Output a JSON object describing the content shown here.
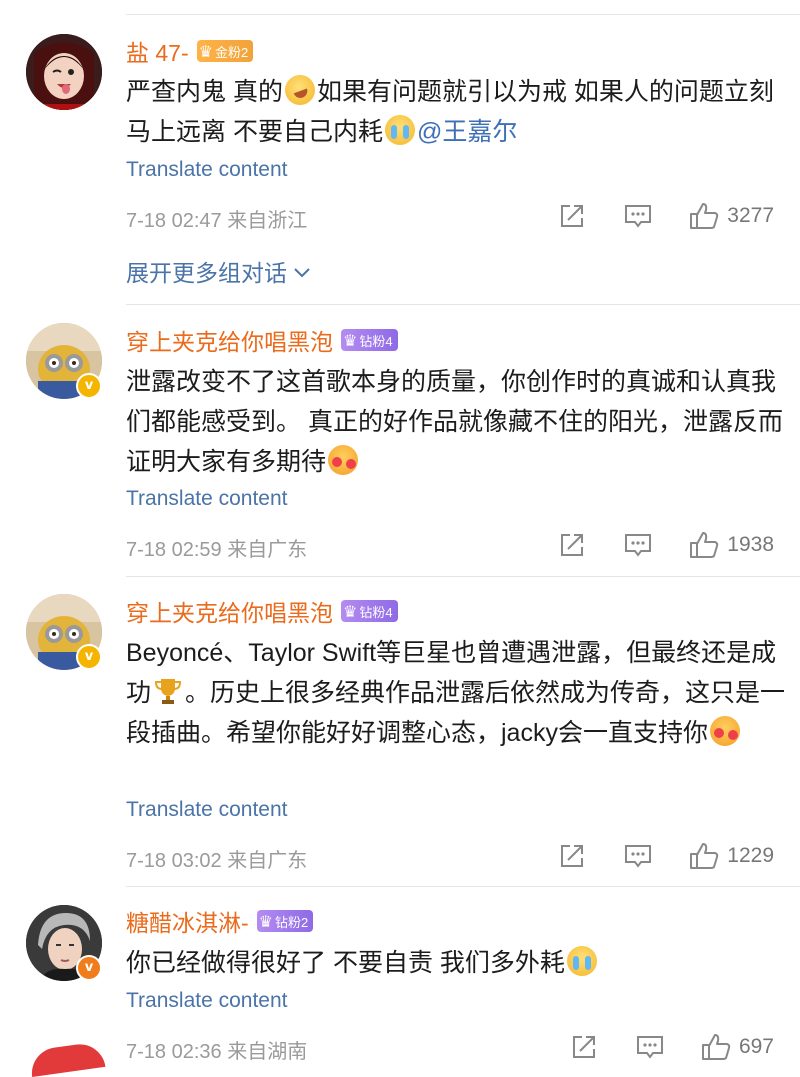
{
  "comments": [
    {
      "username": "盐 47-",
      "badge": "金粉2",
      "text_parts": [
        "严查内鬼 真的",
        "如果有问题就引以为戒 如果人的问题立刻马上远离 不要自己内耗",
        "@王嘉尔"
      ],
      "translate": "Translate content",
      "meta": "7-18 02:47 来自浙江",
      "likes": "3277",
      "expand": "展开更多组对话"
    },
    {
      "username": "穿上夹克给你唱黑泡",
      "badge": "钻粉4",
      "text": "泄露改变不了这首歌本身的质量，你创作时的真诚和认真我们都能感受到。 真正的好作品就像藏不住的阳光，泄露反而证明大家有多期待",
      "translate": "Translate content",
      "meta": "7-18 02:59 来自广东",
      "likes": "1938"
    },
    {
      "username": "穿上夹克给你唱黑泡",
      "badge": "钻粉4",
      "text_parts": [
        "Beyoncé、Taylor Swift等巨星也曾遭遇泄露，但最终还是成功",
        "。历史上很多经典作品泄露后依然成为传奇，这只是一段插曲。希望你能好好调整心态，jacky会一直支持你"
      ],
      "translate": "Translate content",
      "meta": "7-18 03:02 来自广东",
      "likes": "1229"
    },
    {
      "username": "糖醋冰淇淋-",
      "badge": "钻粉2",
      "text": "你已经做得很好了 不要自责 我们多外耗",
      "translate": "Translate content",
      "meta": "7-18 02:36 来自湖南",
      "likes": "697"
    }
  ],
  "colors": {
    "username": "#ea6b1c",
    "link": "#4a74a8",
    "meta": "#9a9a9a"
  },
  "icons": {
    "share": "share-icon",
    "comment": "comment-icon",
    "like": "thumbs-up-icon",
    "expand": "chevron-down-icon"
  }
}
